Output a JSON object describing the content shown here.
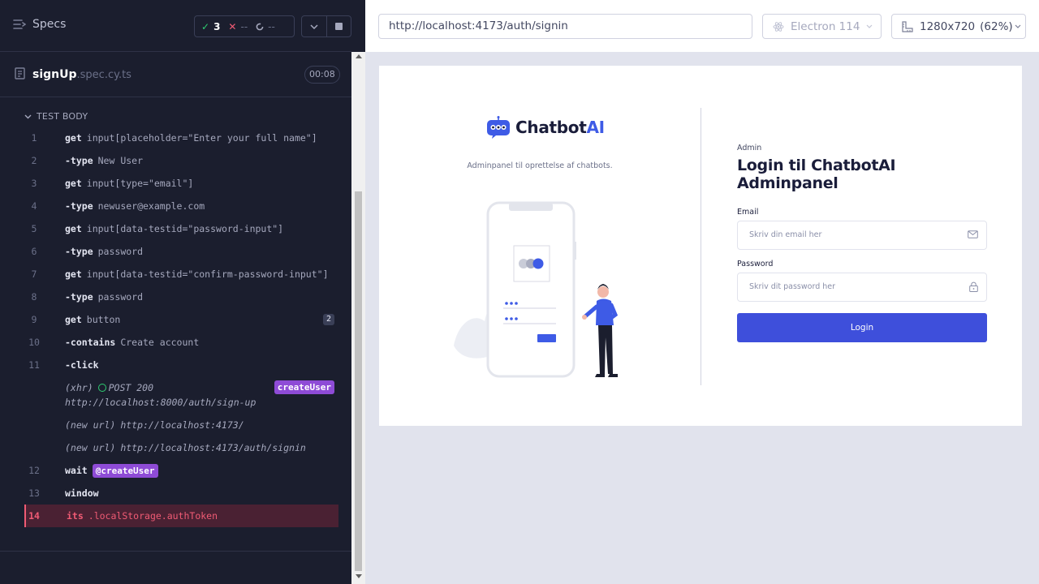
{
  "runner": {
    "specs_label": "Specs",
    "stats": {
      "passed": "3",
      "failed": "--",
      "pending": "--"
    },
    "spec_file": {
      "name": "signUp",
      "ext": ".spec.cy.ts",
      "duration": "00:08"
    },
    "section_title": "TEST BODY",
    "commands": [
      {
        "num": "1",
        "name": "get",
        "msg": "input[placeholder=\"Enter your full name\"]"
      },
      {
        "num": "2",
        "name": "-type",
        "msg": "New User"
      },
      {
        "num": "3",
        "name": "get",
        "msg": "input[type=\"email\"]"
      },
      {
        "num": "4",
        "name": "-type",
        "msg": "newuser@example.com"
      },
      {
        "num": "5",
        "name": "get",
        "msg": "input[data-testid=\"password-input\"]"
      },
      {
        "num": "6",
        "name": "-type",
        "msg": "password"
      },
      {
        "num": "7",
        "name": "get",
        "msg": "input[data-testid=\"confirm-password-input\"]"
      },
      {
        "num": "8",
        "name": "-type",
        "msg": "password"
      },
      {
        "num": "9",
        "name": "get",
        "msg": "button",
        "count": "2"
      },
      {
        "num": "10",
        "name": "-contains",
        "msg": "Create account"
      },
      {
        "num": "11",
        "name": "-click",
        "msg": ""
      },
      {
        "num": "12",
        "name": "wait",
        "msg": "",
        "alias": "@createUser"
      },
      {
        "num": "13",
        "name": "window",
        "msg": ""
      },
      {
        "num": "14",
        "name": "its",
        "msg": ".localStorage.authToken"
      }
    ],
    "events": {
      "xhr": {
        "label": "(xhr)",
        "status": "POST 200",
        "url": "http://localhost:8000/auth/sign-up",
        "alias": "createUser"
      },
      "newurl1": {
        "label": "(new url)",
        "url": "http://localhost:4173/"
      },
      "newurl2": {
        "label": "(new url)",
        "url": "http://localhost:4173/auth/signin"
      }
    }
  },
  "aut_header": {
    "url": "http://localhost:4173/auth/signin",
    "browser": "Electron 114",
    "viewport": "1280x720",
    "scale": "(62%)"
  },
  "app": {
    "brand_main": "Chatbot",
    "brand_accent": "AI",
    "tagline": "Adminpanel til oprettelse af chatbots.",
    "eyebrow": "Admin",
    "heading": "Login til ChatbotAI Adminpanel",
    "email_label": "Email",
    "email_placeholder": "Skriv din email her",
    "password_label": "Password",
    "password_placeholder": "Skriv dit password her",
    "login_button": "Login"
  },
  "colors": {
    "runner_bg": "#1b1e2e",
    "pass": "#2ecc71",
    "fail": "#f05b74",
    "alias": "#8e4bd6",
    "brand_accent": "#3e5be6",
    "login_button": "#3e4fdb"
  }
}
